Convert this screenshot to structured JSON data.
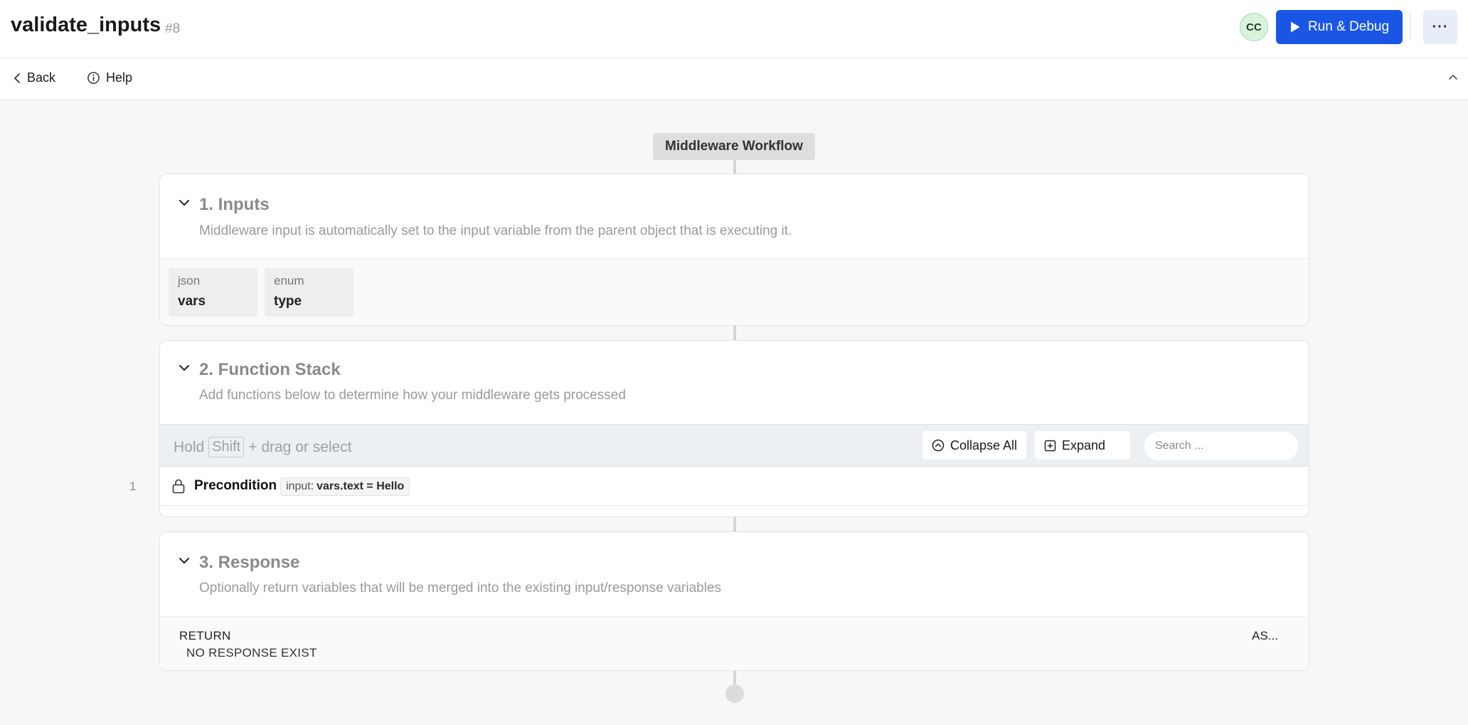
{
  "header": {
    "title": "validate_inputs",
    "number": "#8",
    "avatar_initials": "CC",
    "run_label": "Run & Debug",
    "more_label": "···",
    "run_color": "#1a56e6"
  },
  "subnav": {
    "back_label": "Back",
    "help_label": "Help"
  },
  "workflow": {
    "label": "Middleware Workflow",
    "sections": {
      "inputs": {
        "title": "1. Inputs",
        "description": "Middleware input is automatically set to the input variable from the parent object that is executing it.",
        "variables": [
          {
            "type": "json",
            "name": "vars"
          },
          {
            "type": "enum",
            "name": "type"
          }
        ]
      },
      "function_stack": {
        "title": "2. Function Stack",
        "description": "Add functions below to determine how your middleware gets processed",
        "toolbar": {
          "hint_prefix": "Hold",
          "hint_key": "Shift",
          "hint_suffix": "+ drag or select",
          "collapse_all_label": "Collapse All",
          "expand_label": "Expand",
          "search_placeholder": "Search ..."
        },
        "functions": [
          {
            "index": "1",
            "name": "Precondition",
            "badge_key": "input:",
            "badge_value": "vars.text = Hello"
          }
        ]
      },
      "response": {
        "title": "3. Response",
        "description": "Optionally return variables that will be merged into the existing input/response variables",
        "return_label": "RETURN",
        "empty_label": "NO RESPONSE EXIST",
        "as_label": "AS..."
      }
    }
  }
}
